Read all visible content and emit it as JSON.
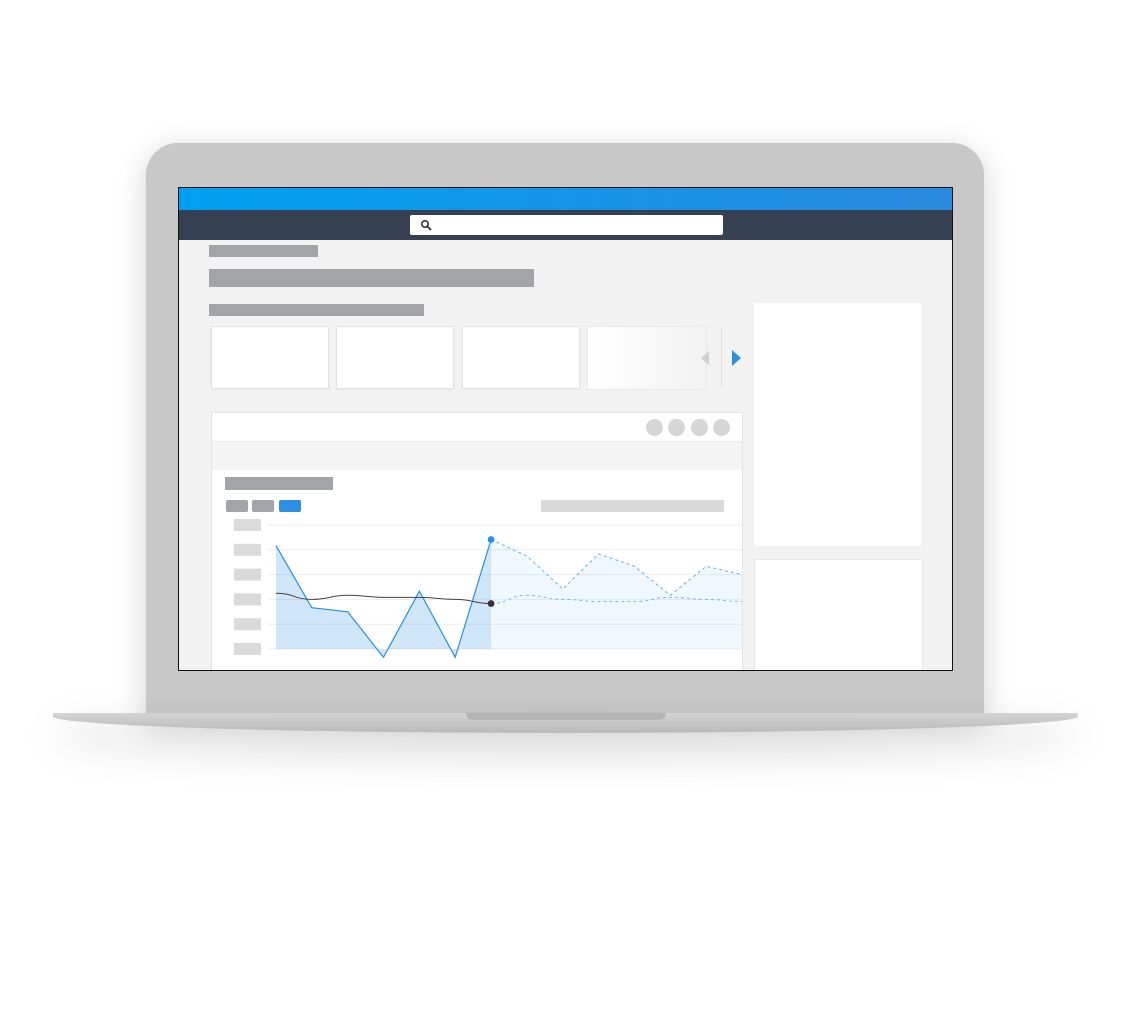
{
  "search": {
    "value": "",
    "placeholder": ""
  },
  "colors": {
    "topbar": "#0aa0f2",
    "navbar": "#354153",
    "accent": "#2b8fe2",
    "skeleton": "#a2a4a8",
    "skeleton_light": "#d9d9d9",
    "page_bg": "#f2f2f2"
  },
  "icons": {
    "search": "search-icon",
    "carousel_prev": "chevron-left-icon",
    "carousel_next": "chevron-right-icon"
  },
  "carousel": {
    "card_count": 4,
    "active_index": 0
  },
  "chart_toolbar": {
    "button_count": 4
  },
  "chart_tabs": {
    "count": 3,
    "active_index": 2
  },
  "chart_data": {
    "type": "line",
    "title": "",
    "xlabel": "",
    "ylabel": "",
    "grid": true,
    "ylim": [
      0,
      6
    ],
    "x": [
      0,
      1,
      2,
      3,
      4,
      5,
      6,
      7,
      8,
      9,
      10,
      11,
      12,
      13
    ],
    "marker_index": 6,
    "series": [
      {
        "style": "area",
        "color": "#2b8fe2",
        "values": [
          5.0,
          2.0,
          1.8,
          -0.4,
          2.8,
          -0.4,
          5.3,
          4.5,
          2.9,
          4.6,
          4.0,
          2.6,
          4.0,
          3.6
        ]
      },
      {
        "style": "line",
        "color": "#444444",
        "values": [
          2.7,
          2.4,
          2.6,
          2.5,
          2.5,
          2.4,
          2.2,
          2.6,
          2.4,
          2.3,
          2.3,
          2.5,
          2.4,
          2.3
        ]
      }
    ]
  }
}
